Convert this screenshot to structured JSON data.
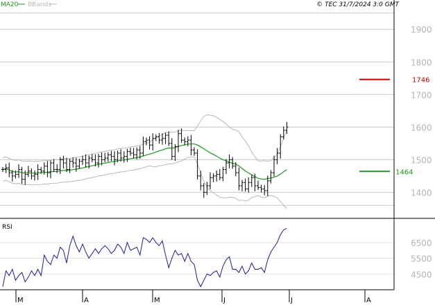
{
  "header": {
    "legend_ma": "MA20",
    "legend_bb": "BBands",
    "copyright": "© TEC 31/7/2024 3:0 GMT"
  },
  "colors": {
    "ma": "#1a9a1a",
    "bbands": "#b8b8b8",
    "price": "#000000",
    "rsi": "#1a1aa0",
    "resistance": "#c00000",
    "support": "#1a9a1a",
    "grid": "#c8c8c8",
    "axis_text": "#b4b4b4"
  },
  "chart_data": [
    {
      "type": "ohlc",
      "name": "price",
      "ylim": [
        1320,
        1960
      ],
      "yticks": [
        1400,
        1500,
        1600,
        1700,
        1800,
        1900
      ],
      "xticks": [
        "M",
        "A",
        "M",
        "J",
        "J",
        "A"
      ],
      "close": [
        1470,
        1475,
        1460,
        1450,
        1455,
        1470,
        1440,
        1455,
        1465,
        1450,
        1455,
        1470,
        1465,
        1480,
        1460,
        1490,
        1470,
        1470,
        1500,
        1490,
        1470,
        1495,
        1490,
        1480,
        1495,
        1500,
        1490,
        1505,
        1500,
        1490,
        1510,
        1500,
        1505,
        1515,
        1510,
        1500,
        1520,
        1505,
        1510,
        1525,
        1520,
        1515,
        1530,
        1520,
        1555,
        1560,
        1545,
        1565,
        1570,
        1560,
        1565,
        1575,
        1550,
        1510,
        1540,
        1580,
        1560,
        1555,
        1560,
        1530,
        1520,
        1450,
        1420,
        1400,
        1420,
        1445,
        1450,
        1455,
        1445,
        1470,
        1490,
        1500,
        1480,
        1460,
        1420,
        1430,
        1410,
        1430,
        1445,
        1420,
        1415,
        1410,
        1405,
        1435,
        1460,
        1500,
        1520,
        1570,
        1590,
        1600
      ],
      "levels": [
        {
          "value": 1746,
          "label": "1746",
          "color": "#c00000"
        },
        {
          "value": 1464,
          "label": "1464",
          "color": "#1a9a1a"
        }
      ]
    },
    {
      "type": "line",
      "name": "RSI",
      "label": "RSI",
      "ylim": [
        35,
        79
      ],
      "yticks": [
        45,
        55,
        65
      ],
      "tick_labels": [
        "4500",
        "5500",
        "6500"
      ],
      "values": [
        37,
        47,
        44,
        48,
        41,
        44,
        46,
        40,
        43,
        47,
        44,
        48,
        44,
        57,
        53,
        51,
        57,
        55,
        62,
        60,
        52,
        63,
        69,
        63,
        59,
        64,
        59,
        55,
        58,
        61,
        58,
        61,
        63,
        61,
        58,
        60,
        64,
        62,
        58,
        65,
        60,
        61,
        62,
        57,
        68,
        67,
        65,
        68,
        65,
        63,
        66,
        57,
        49,
        55,
        60,
        57,
        58,
        53,
        58,
        53,
        51,
        41,
        37,
        41,
        45,
        44,
        46,
        47,
        43,
        50,
        54,
        56,
        48,
        48,
        46,
        50,
        45,
        47,
        52,
        48,
        48,
        49,
        46,
        54,
        59,
        62,
        65,
        70,
        73,
        74
      ]
    }
  ]
}
